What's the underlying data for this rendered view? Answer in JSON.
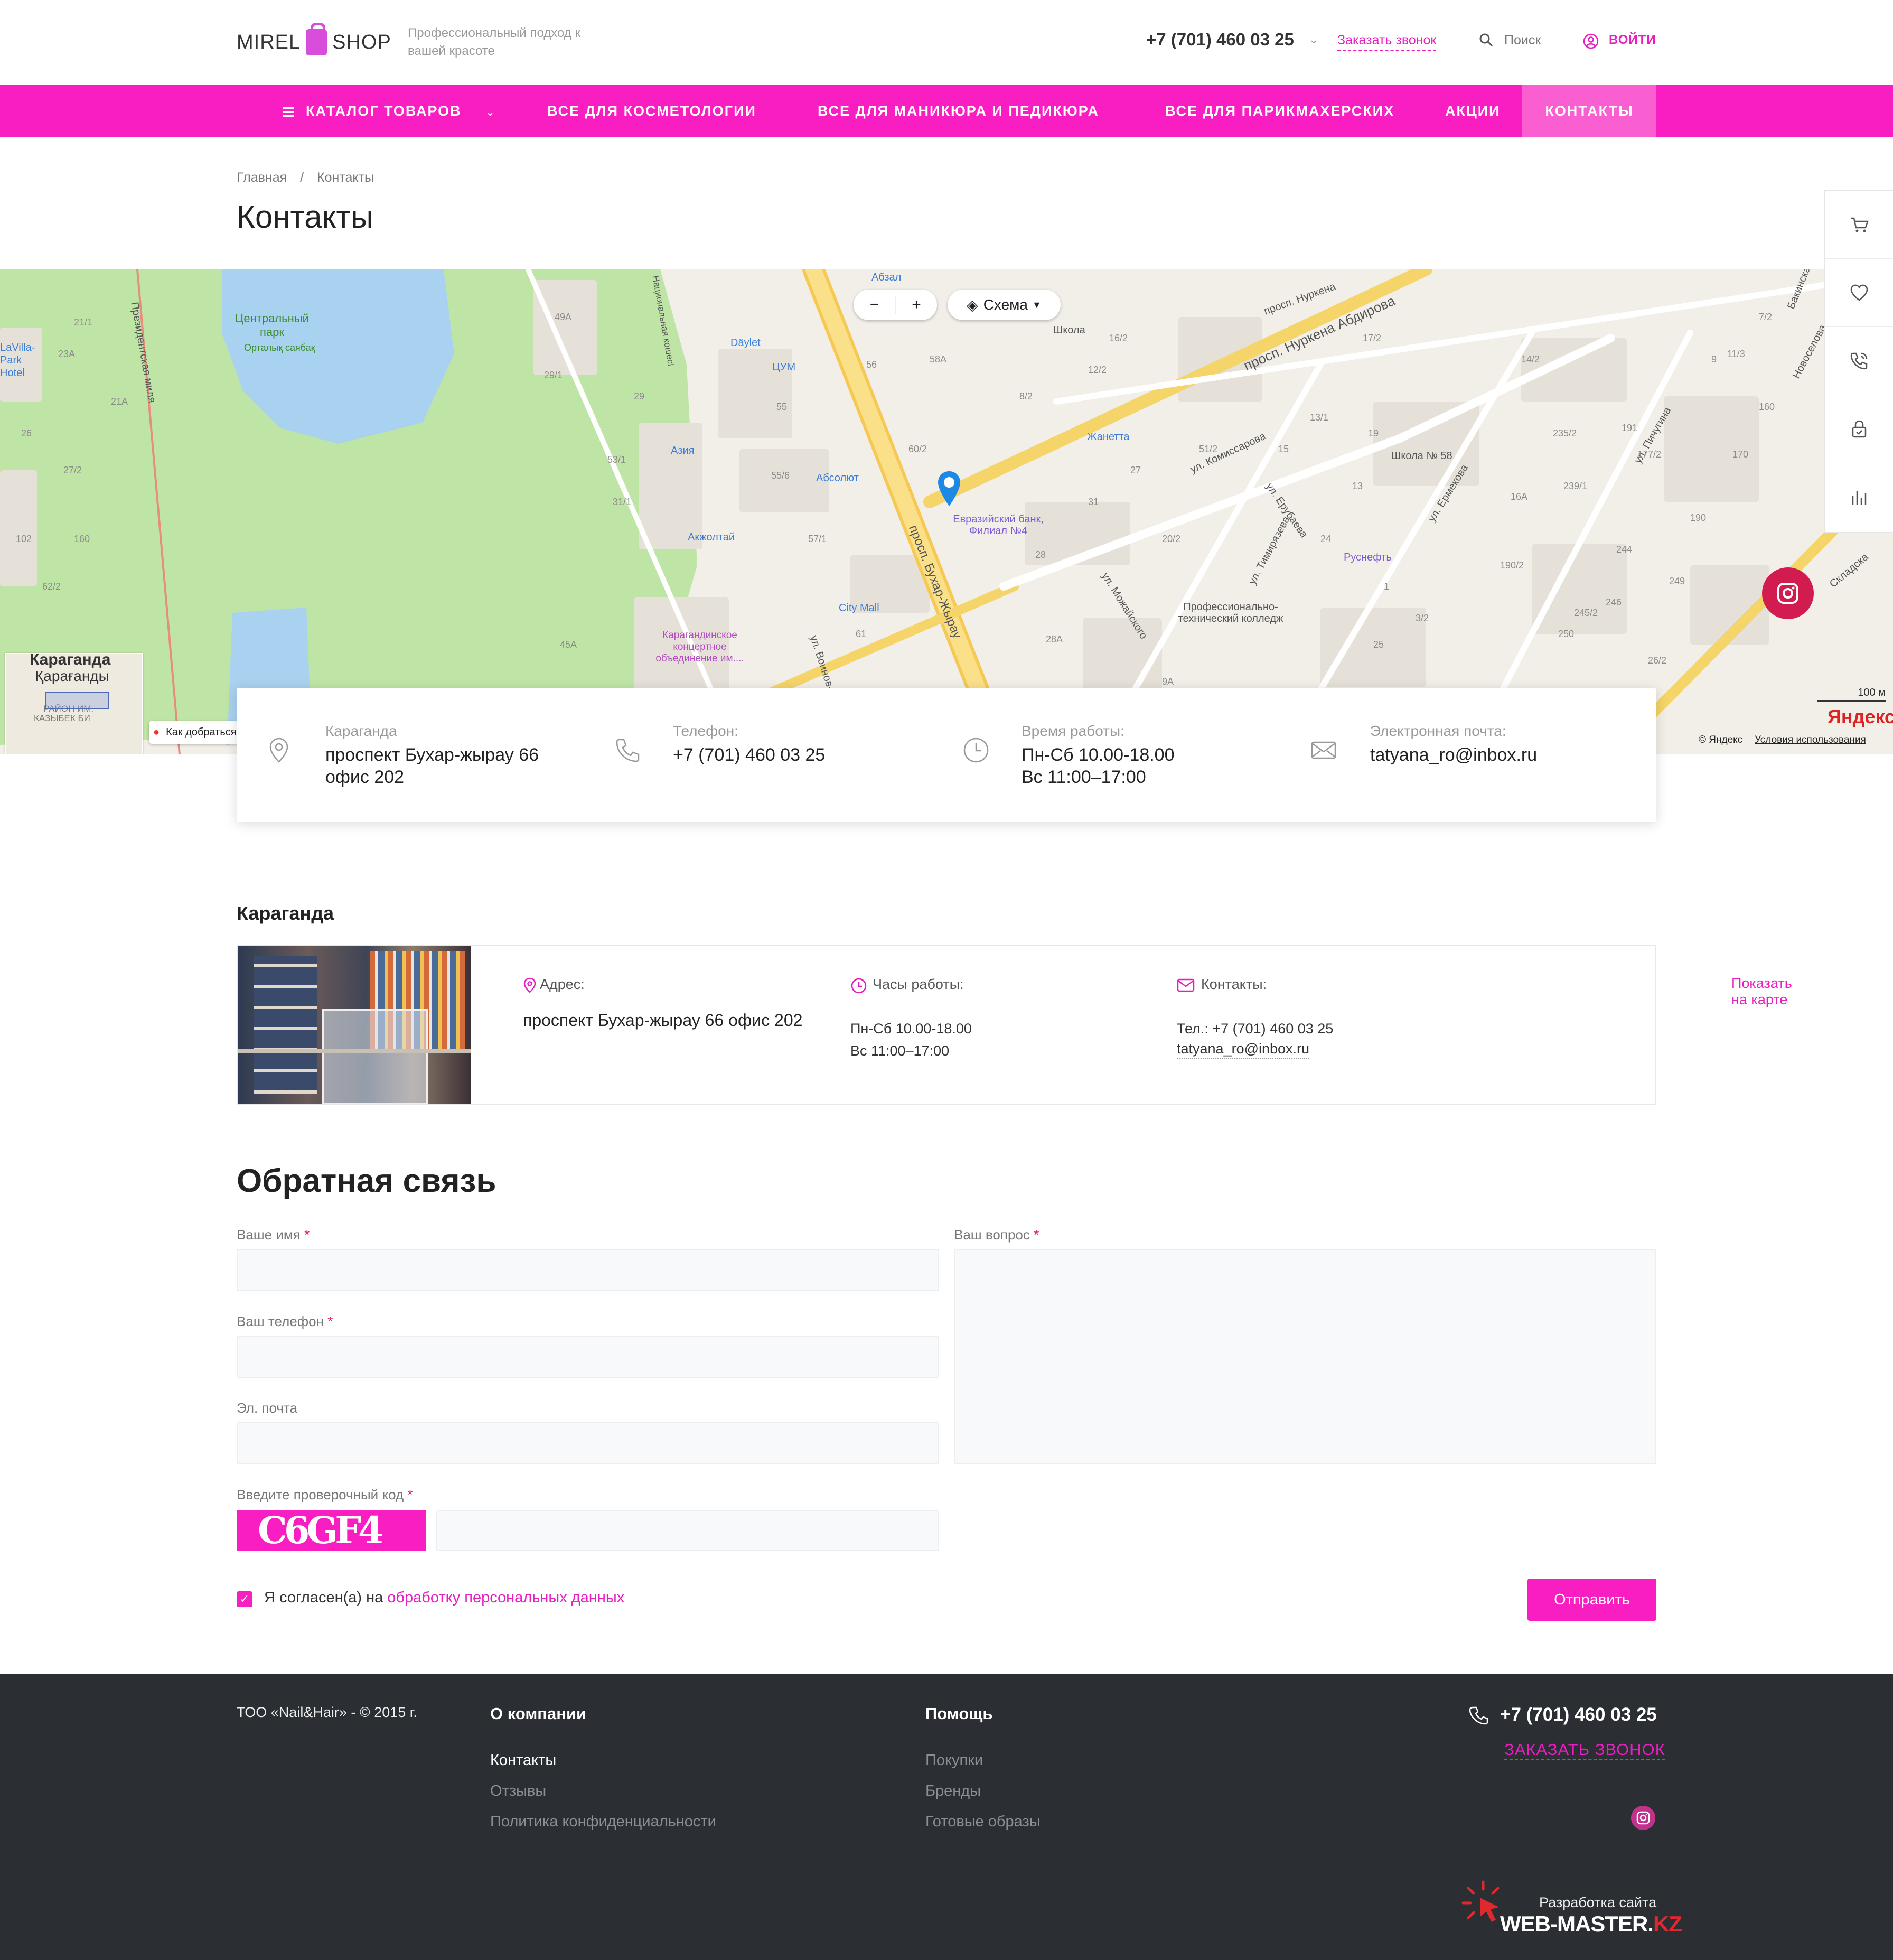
{
  "header": {
    "logo_left": "MIREL",
    "logo_right": "SHOP",
    "tagline": "Профессиональный подход к вашей красоте",
    "phone": "+7 (701) 460 03 25",
    "callback": "Заказать звонок",
    "search": "Поиск",
    "login": "ВОЙТИ"
  },
  "nav": {
    "items": [
      {
        "label": "КАТАЛОГ ТОВАРОВ"
      },
      {
        "label": "ВСЕ ДЛЯ КОСМЕТОЛОГИИ"
      },
      {
        "label": "ВСЕ ДЛЯ МАНИКЮРА И ПЕДИКЮРА"
      },
      {
        "label": "ВСЕ ДЛЯ ПАРИКМАХЕРСКИХ"
      },
      {
        "label": "АКЦИИ"
      },
      {
        "label": "КОНТАКТЫ"
      }
    ],
    "active": "КОНТАКТЫ",
    "color": "#f91ec2"
  },
  "breadcrumb": {
    "home": "Главная",
    "separator": "/",
    "current": "Контакты"
  },
  "page_title": "Контакты",
  "map": {
    "scheme_label": "Схема",
    "scale": "100 м",
    "provider": "© Яндекс",
    "terms": "Условия использования",
    "brand": "Яндекс",
    "route": "Как добраться",
    "minimap_city": "Караганда",
    "minimap_city_kz": "Қарағанды",
    "minimap_district": "КАЗЫБЕК БИ",
    "minimap_district2": "РАЙОН ИМ.",
    "labels": {
      "park": "Центральный парк",
      "park_kz": "Орталық саябақ",
      "hotel": "LaVilla-Park Hotel",
      "street_president": "Президентская миля",
      "street_buhar": "просп. Бухар-Жырау",
      "street_abdirov": "просп. Нуркена Абдирова",
      "street_nurkena": "просп. Нуркена",
      "street_komissarova": "ул. Комиссарова",
      "street_erubaeva": "ул. Ерубаева",
      "street_ermekova": "ул. Ермекова",
      "street_timiryazeva": "ул. Тимирязева",
      "street_mozhayskogo": "ул. Можайского",
      "street_voinov": "ул. Воинов-",
      "street_pichugina": "ул. Пичугина",
      "street_novoselova": "Новоселова",
      "street_bakinskaya": "Бакинская",
      "street_skladskaya": "Складска",
      "street_nac": "Национальная кошесі",
      "poi_dayler": "Däylet",
      "poi_tsum": "ЦУМ",
      "poi_aziya": "Азия",
      "poi_absolut": "Абсолют",
      "poi_akzholtai": "Акжолтай",
      "poi_citymall": "City Mall",
      "poi_concert": "Карагандинское концертное объединение им....",
      "poi_bank": "Евразийский банк, Филиал №4",
      "poi_zhanetta": "Жанетта",
      "poi_school58": "Школа № 58",
      "poi_shkola": "Школа",
      "poi_rusnef": "Руснефть",
      "poi_college": "Профессионально-технический колледж",
      "poi_abzal": "Абзал"
    },
    "houses": [
      "21/1",
      "23А",
      "26",
      "21А",
      "27/2",
      "102",
      "160",
      "62/2",
      "49А",
      "29/1",
      "29",
      "53/1",
      "31/1",
      "55",
      "55/6",
      "57/1",
      "61",
      "45А",
      "60/2",
      "56",
      "58А",
      "8/2",
      "12/2",
      "16/2",
      "17/2",
      "19",
      "13/1",
      "15",
      "51/2",
      "27",
      "31",
      "28",
      "28А",
      "9А",
      "20/2",
      "24",
      "14/2",
      "235/2",
      "191",
      "177/2",
      "170",
      "160",
      "16А",
      "239/1",
      "244",
      "246",
      "245/2",
      "190/2",
      "249",
      "250",
      "26/2",
      "25",
      "3/2",
      "7/2",
      "11/3",
      "13",
      "1",
      "9",
      "190"
    ]
  },
  "info_card": {
    "city": "Караганда",
    "address": "проспект Бухар-жырау 66 офис 202",
    "phone_label": "Телефон:",
    "phone": "+7 (701) 460 03 25",
    "hours_label": "Время работы:",
    "hours_line1": "Пн-Сб 10.00-18.00",
    "hours_line2": "Вс 11:00–17:00",
    "email_label": "Электронная почта:",
    "email": "tatyana_ro@inbox.ru"
  },
  "store": {
    "city": "Караганда",
    "address_label": "Адрес:",
    "address": "проспект Бухар-жырау 66 офис 202",
    "hours_label": "Часы работы:",
    "hours_line1": "Пн-Сб 10.00-18.00",
    "hours_line2": "Вс 11:00–17:00",
    "contacts_label": "Контакты:",
    "phone": "Тел.: +7 (701) 460 03 25",
    "email": "tatyana_ro@inbox.ru",
    "show_on_map": "Показать на карте"
  },
  "feedback": {
    "title": "Обратная связь",
    "name_label": "Ваше имя",
    "phone_label": "Ваш телефон",
    "email_label": "Эл. почта",
    "question_label": "Ваш вопрос",
    "captcha_label": "Введите проверочный код",
    "captcha_text": "C6GF4",
    "required_mark": "*",
    "agree_text": "Я согласен(а) на",
    "agree_link": "обработку персональных данных",
    "submit": "Отправить",
    "agree_checked": true
  },
  "footer": {
    "copyright": "ТОО «Nail&Hair» - © 2015 г.",
    "col1_title": "О компании",
    "col1_links": [
      "Контакты",
      "Отзывы",
      "Политика конфиденциальности"
    ],
    "col2_title": "Помощь",
    "col2_links": [
      "Покупки",
      "Бренды",
      "Готовые образы"
    ],
    "phone": "+7 (701) 460 03 25",
    "callback": "ЗАКАЗАТЬ ЗВОНОК",
    "dev_label": "Разработка сайта",
    "dev_brand": "WEB-MASTER.",
    "dev_brand_tld": "KZ"
  }
}
